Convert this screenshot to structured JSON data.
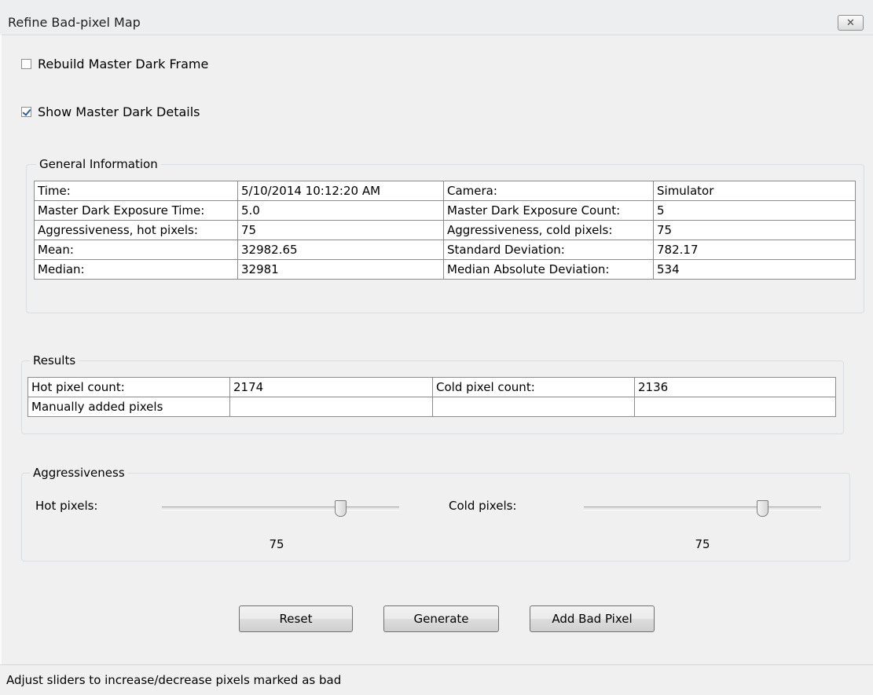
{
  "window": {
    "title": "Refine Bad-pixel Map",
    "close_glyph": "✕"
  },
  "options": {
    "rebuild_label": "Rebuild Master Dark Frame",
    "rebuild_checked": false,
    "show_details_label": "Show Master Dark Details",
    "show_details_checked": true
  },
  "general": {
    "legend": "General Information",
    "rows": [
      [
        "Time:",
        "5/10/2014  10:12:20 AM",
        "Camera:",
        "Simulator"
      ],
      [
        "Master Dark Exposure Time:",
        "5.0",
        "Master Dark Exposure Count:",
        "5"
      ],
      [
        "Aggressiveness, hot pixels:",
        "75",
        "Aggressiveness, cold pixels:",
        "75"
      ],
      [
        "Mean:",
        "32982.65",
        "Standard Deviation:",
        "782.17"
      ],
      [
        "Median:",
        "32981",
        "Median Absolute Deviation:",
        "534"
      ]
    ]
  },
  "results": {
    "legend": "Results",
    "rows": [
      [
        "Hot pixel count:",
        "2174",
        "Cold pixel count:",
        "2136"
      ],
      [
        "Manually added pixels",
        "",
        "",
        ""
      ]
    ]
  },
  "aggressiveness": {
    "legend": "Aggressiveness",
    "hot_label": "Hot pixels:",
    "hot_value": "75",
    "hot_fraction": 0.75,
    "cold_label": "Cold pixels:",
    "cold_value": "75",
    "cold_fraction": 0.75
  },
  "buttons": {
    "reset": "Reset",
    "generate": "Generate",
    "add_bad_pixel": "Add Bad Pixel"
  },
  "status": {
    "text": "Adjust sliders to increase/decrease pixels marked as bad"
  }
}
